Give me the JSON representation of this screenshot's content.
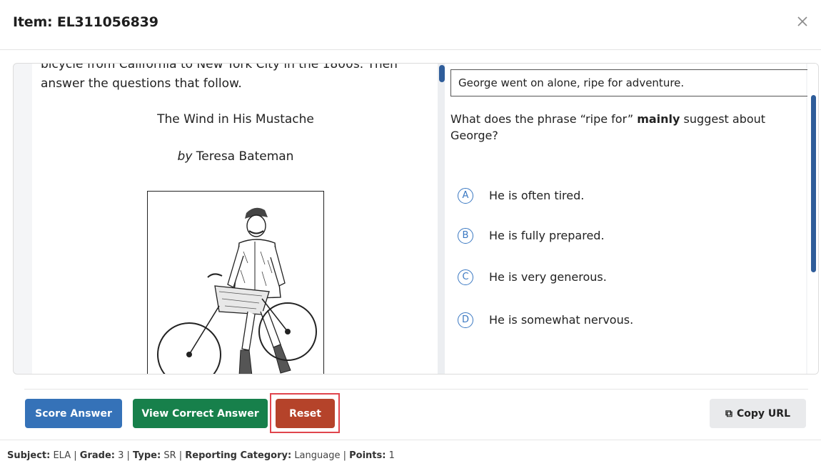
{
  "header": {
    "title": "Item: EL311056839",
    "close_icon": "close-icon"
  },
  "passage": {
    "intro": "bicycle from California to New York City in the 1800s. Then answer the questions that follow.",
    "story_title": "The Wind in His Mustache",
    "byline_prefix": "by",
    "author": "Teresa Bateman",
    "illustration": "man-with-bicycle-illustration"
  },
  "question": {
    "stem": "George went on alone, ripe for adventure.",
    "prompt_before": "What does the phrase “ripe for” ",
    "prompt_bold": "mainly",
    "prompt_after": " suggest about George?",
    "options": [
      {
        "letter": "A",
        "text": "He is often tired."
      },
      {
        "letter": "B",
        "text": "He is fully prepared."
      },
      {
        "letter": "C",
        "text": "He is very generous."
      },
      {
        "letter": "D",
        "text": "He is somewhat nervous."
      }
    ]
  },
  "actions": {
    "score_label": "Score Answer",
    "view_label": "View Correct Answer",
    "reset_label": "Reset",
    "copy_label": "Copy URL",
    "copy_icon": "copy-icon"
  },
  "meta": {
    "subject_label": "Subject:",
    "subject": "ELA",
    "grade_label": "Grade:",
    "grade": "3",
    "type_label": "Type:",
    "type": "SR",
    "category_label": "Reporting Category:",
    "category": "Language",
    "points_label": "Points:",
    "points": "1"
  },
  "colors": {
    "score": "#3572b8",
    "view": "#17804b",
    "reset": "#b5432a",
    "highlight": "#e0454d",
    "option_accent": "#3a78c2"
  }
}
